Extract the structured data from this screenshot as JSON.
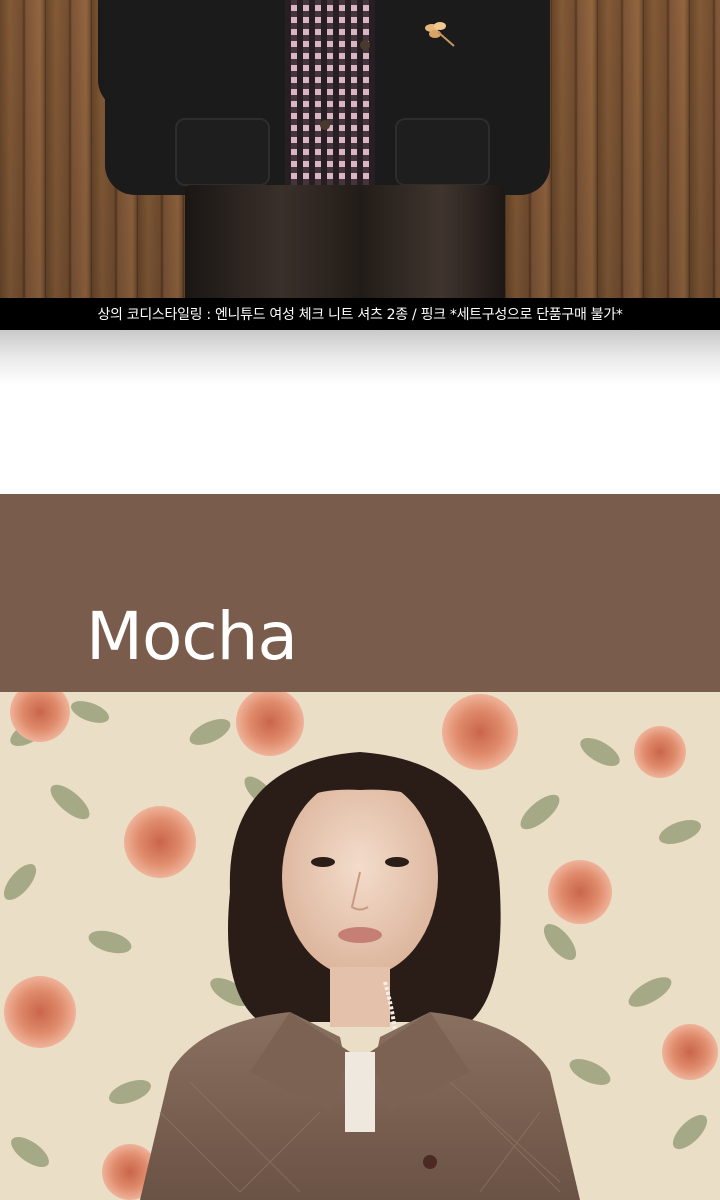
{
  "top_photo": {
    "alt": "model wearing black quilted jacket with pink check knit shirt and black leather skirt"
  },
  "caption": {
    "text": "상의 코디스타일링 : 엔니튜드 여성 체크 니트 셔츠 2종 / 핑크  *세트구성으로 단품구매 불가*"
  },
  "section": {
    "color_name": "Mocha",
    "banner_color": "#7a5c4c"
  },
  "bottom_photo": {
    "alt": "model with bob hair wearing mocha quilted collar jacket in front of rose wallpaper"
  }
}
